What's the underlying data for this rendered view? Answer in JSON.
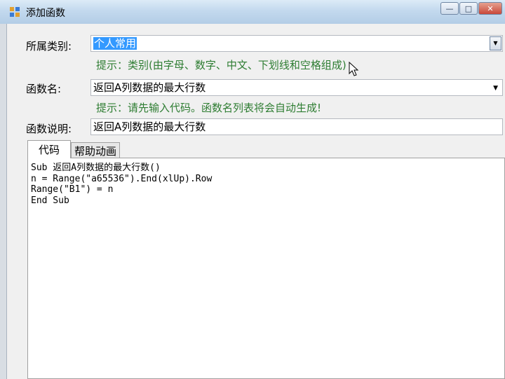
{
  "window": {
    "title": "添加函数",
    "minimize_glyph": "—",
    "maximize_glyph": "□",
    "close_glyph": "✕"
  },
  "form": {
    "category_label": "所属类别:",
    "category_value": "个人常用",
    "category_hint": "提示：类别(由字母、数字、中文、下划线和空格组成)",
    "name_label": "函数名:",
    "name_value": "返回A列数据的最大行数",
    "name_hint": "提示：请先输入代码。函数名列表将会自动生成!",
    "desc_label": "函数说明:",
    "desc_value": "返回A列数据的最大行数"
  },
  "tabs": [
    {
      "label": "代码",
      "active": true
    },
    {
      "label": "帮助动画",
      "active": false
    }
  ],
  "code_lines": [
    "Sub 返回A列数据的最大行数()",
    "n = Range(\"a65536\").End(xlUp).Row",
    "Range(\"B1\") = n",
    "End Sub"
  ],
  "colors": {
    "hint": "#2e7d32",
    "selection": "#3399ff",
    "titlebar": "#c3d9ee"
  },
  "icons": [
    "app-icon",
    "minimize-icon",
    "maximize-icon",
    "close-icon",
    "dropdown-arrow-icon",
    "mouse-cursor-icon"
  ]
}
